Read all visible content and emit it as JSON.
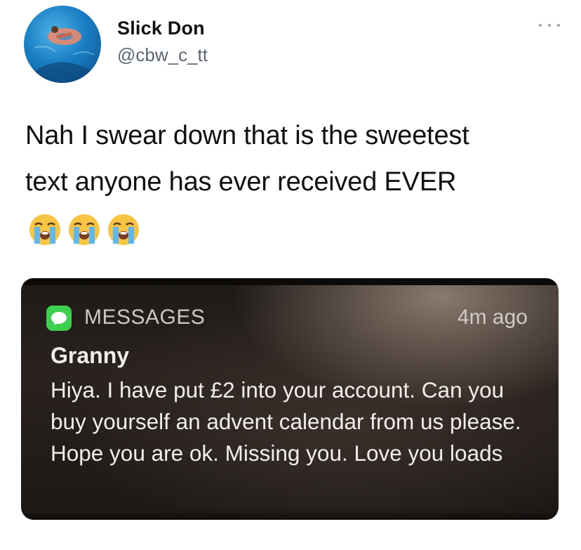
{
  "tweet": {
    "author": {
      "display_name": "Slick Don",
      "handle": "@cbw_c_tt",
      "avatar_icon": "avatar-photo"
    },
    "menu_icon": "more-options-icon",
    "text_line1": "Nah I swear down that is the sweetest",
    "text_line2": "text anyone has ever received EVER",
    "emojis": [
      "😭",
      "😭",
      "😭"
    ]
  },
  "notification": {
    "app_icon": "messages-app-icon",
    "app_name": "MESSAGES",
    "timestamp": "4m ago",
    "sender": "Granny",
    "body": "Hiya. I have put £2 into your account. Can you buy yourself an advent calendar from us please. Hope you are ok. Missing you. Love you loads",
    "accent_color": "#3fcf4f"
  }
}
